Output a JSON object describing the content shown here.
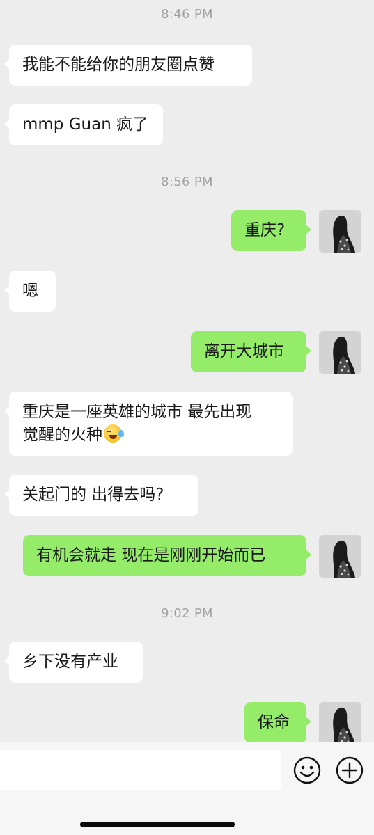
{
  "messages": [
    {
      "kind": "time",
      "text": "8:46 PM"
    },
    {
      "kind": "in",
      "text": "我能不能给你的朋友圈点赞"
    },
    {
      "kind": "in",
      "text": "mmp Guan 疯了"
    },
    {
      "kind": "time",
      "text": "8:56 PM"
    },
    {
      "kind": "out",
      "text": "重庆?"
    },
    {
      "kind": "in",
      "text": "嗯"
    },
    {
      "kind": "out",
      "text": "离开大城市"
    },
    {
      "kind": "in",
      "lines": [
        "重庆是一座英雄的城市 最先出现",
        "觉醒的火种"
      ],
      "emoji": "laughing-crying-emoji"
    },
    {
      "kind": "in",
      "text": "关起门的 出得去吗?"
    },
    {
      "kind": "out",
      "text": "有机会就走 现在是刚刚开始而已"
    },
    {
      "kind": "time",
      "text": "9:02 PM"
    },
    {
      "kind": "in",
      "text": "乡下没有产业"
    },
    {
      "kind": "out",
      "text": "保命"
    }
  ],
  "avatar_icon": "user-avatar-photo",
  "composer": {
    "input_value": "",
    "emoji_icon": "smiley-face-icon",
    "plus_icon": "plus-circle-icon"
  },
  "colors": {
    "background": "#ededed",
    "incoming_bubble": "#ffffff",
    "outgoing_bubble": "#95ec69",
    "timestamp": "#a3a3a3"
  }
}
